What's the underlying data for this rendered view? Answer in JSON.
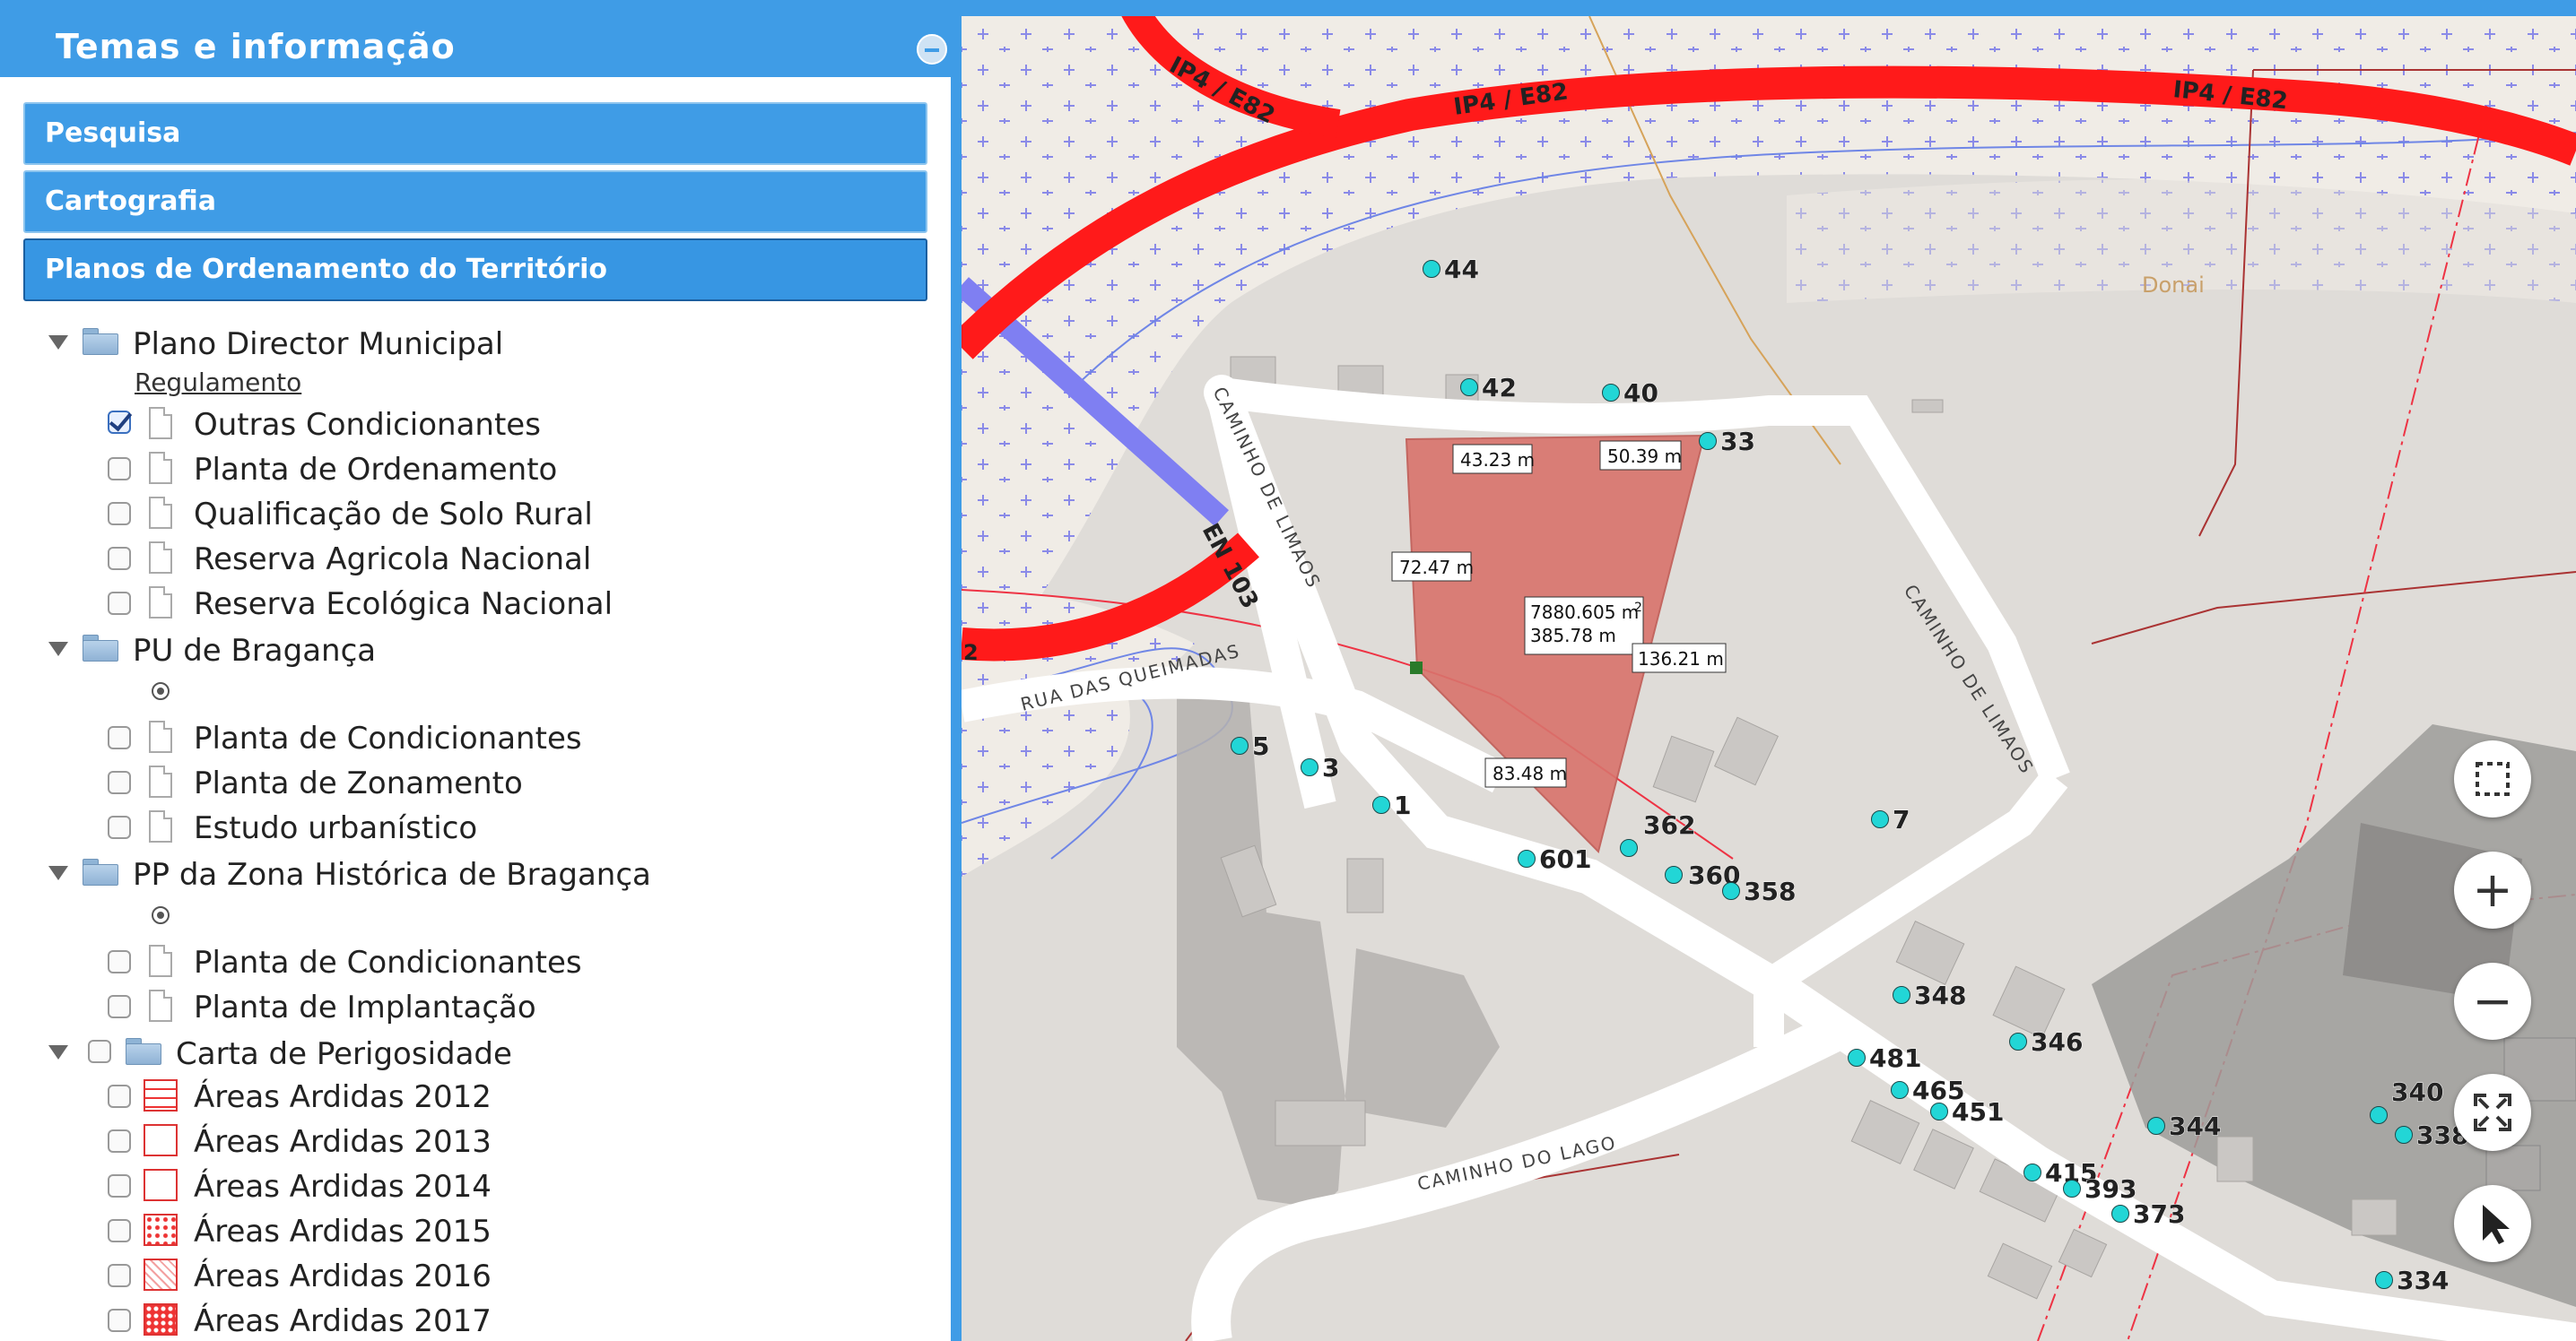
{
  "panel": {
    "title": "Temas e informação",
    "sections": [
      "Pesquisa",
      "Cartografia",
      "Planos de Ordenamento do Território"
    ]
  },
  "tree": {
    "pdm": {
      "label": "Plano Director Municipal",
      "link": "Regulamento",
      "layers": [
        "Outras Condicionantes",
        "Planta de Ordenamento",
        "Qualificação de Solo Rural",
        "Reserva Agricola Nacional",
        "Reserva Ecológica Nacional"
      ],
      "checked": [
        true,
        false,
        false,
        false,
        false
      ]
    },
    "pu": {
      "label": "PU de Bragança",
      "layers": [
        "Planta de Condicionantes",
        "Planta de Zonamento",
        "Estudo urbanístico"
      ]
    },
    "pp": {
      "label": "PP da Zona Histórica de Bragança",
      "layers": [
        "Planta de Condicionantes",
        "Planta de Implantação"
      ]
    },
    "carta": {
      "label": "Carta de Perigosidade",
      "layers": [
        "Áreas Ardidas 2012",
        "Áreas Ardidas 2013",
        "Áreas Ardidas 2014",
        "Áreas Ardidas 2015",
        "Áreas Ardidas 2016",
        "Áreas Ardidas 2017"
      ]
    }
  },
  "map": {
    "road_labels": {
      "ip4_1": "IP4 / E82",
      "ip4_2": "IP4 / E82",
      "ip4_3": "IP4 / E82",
      "en103": "EN 103",
      "caminho_limaos_1": "CAMINHO DE LIMAOS",
      "caminho_limaos_2": "CAMINHO DE LIMAOS",
      "rua_queimadas": "RUA DAS QUEIMADAS",
      "caminho_lago": "CAMINHO DO LAGO",
      "donai": "Donai",
      "edge_2": "2"
    },
    "measurements": {
      "top_left": "43.23 m",
      "top_right": "50.39 m",
      "left": "72.47 m",
      "area": "7880.605 m",
      "area_sup": "2",
      "perimeter": "385.78 m",
      "right": "136.21 m",
      "bottom": "83.48 m"
    },
    "address_points": [
      "44",
      "42",
      "40",
      "33",
      "5",
      "3",
      "1",
      "601",
      "362",
      "360",
      "358",
      "7",
      "348",
      "346",
      "481",
      "465",
      "451",
      "344",
      "340",
      "338",
      "415",
      "393",
      "373",
      "334"
    ],
    "colors": {
      "highway": "#ff1a1a",
      "national_road": "#7f7ff2",
      "parcel_fill": "#d9736c",
      "address_dot": "#22d6d6",
      "land_pattern": "#f0ece6"
    },
    "controls": {
      "select": "select-box-icon",
      "zoom_in": "+",
      "zoom_out": "−",
      "fullscreen": "fullscreen-icon",
      "pointer": "pointer-icon"
    }
  }
}
